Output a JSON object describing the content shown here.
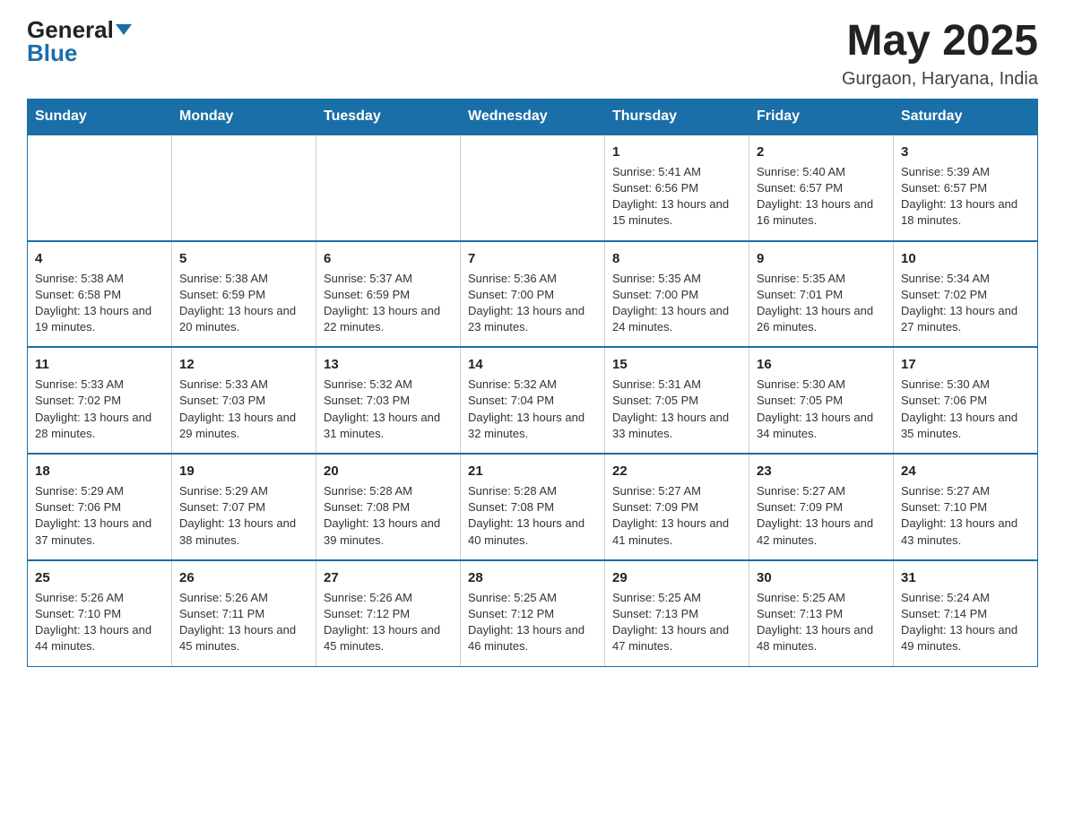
{
  "header": {
    "logo_general": "General",
    "logo_blue": "Blue",
    "title": "May 2025",
    "location": "Gurgaon, Haryana, India"
  },
  "calendar": {
    "days_of_week": [
      "Sunday",
      "Monday",
      "Tuesday",
      "Wednesday",
      "Thursday",
      "Friday",
      "Saturday"
    ],
    "weeks": [
      [
        {
          "day": "",
          "info": ""
        },
        {
          "day": "",
          "info": ""
        },
        {
          "day": "",
          "info": ""
        },
        {
          "day": "",
          "info": ""
        },
        {
          "day": "1",
          "info": "Sunrise: 5:41 AM\nSunset: 6:56 PM\nDaylight: 13 hours and 15 minutes."
        },
        {
          "day": "2",
          "info": "Sunrise: 5:40 AM\nSunset: 6:57 PM\nDaylight: 13 hours and 16 minutes."
        },
        {
          "day": "3",
          "info": "Sunrise: 5:39 AM\nSunset: 6:57 PM\nDaylight: 13 hours and 18 minutes."
        }
      ],
      [
        {
          "day": "4",
          "info": "Sunrise: 5:38 AM\nSunset: 6:58 PM\nDaylight: 13 hours and 19 minutes."
        },
        {
          "day": "5",
          "info": "Sunrise: 5:38 AM\nSunset: 6:59 PM\nDaylight: 13 hours and 20 minutes."
        },
        {
          "day": "6",
          "info": "Sunrise: 5:37 AM\nSunset: 6:59 PM\nDaylight: 13 hours and 22 minutes."
        },
        {
          "day": "7",
          "info": "Sunrise: 5:36 AM\nSunset: 7:00 PM\nDaylight: 13 hours and 23 minutes."
        },
        {
          "day": "8",
          "info": "Sunrise: 5:35 AM\nSunset: 7:00 PM\nDaylight: 13 hours and 24 minutes."
        },
        {
          "day": "9",
          "info": "Sunrise: 5:35 AM\nSunset: 7:01 PM\nDaylight: 13 hours and 26 minutes."
        },
        {
          "day": "10",
          "info": "Sunrise: 5:34 AM\nSunset: 7:02 PM\nDaylight: 13 hours and 27 minutes."
        }
      ],
      [
        {
          "day": "11",
          "info": "Sunrise: 5:33 AM\nSunset: 7:02 PM\nDaylight: 13 hours and 28 minutes."
        },
        {
          "day": "12",
          "info": "Sunrise: 5:33 AM\nSunset: 7:03 PM\nDaylight: 13 hours and 29 minutes."
        },
        {
          "day": "13",
          "info": "Sunrise: 5:32 AM\nSunset: 7:03 PM\nDaylight: 13 hours and 31 minutes."
        },
        {
          "day": "14",
          "info": "Sunrise: 5:32 AM\nSunset: 7:04 PM\nDaylight: 13 hours and 32 minutes."
        },
        {
          "day": "15",
          "info": "Sunrise: 5:31 AM\nSunset: 7:05 PM\nDaylight: 13 hours and 33 minutes."
        },
        {
          "day": "16",
          "info": "Sunrise: 5:30 AM\nSunset: 7:05 PM\nDaylight: 13 hours and 34 minutes."
        },
        {
          "day": "17",
          "info": "Sunrise: 5:30 AM\nSunset: 7:06 PM\nDaylight: 13 hours and 35 minutes."
        }
      ],
      [
        {
          "day": "18",
          "info": "Sunrise: 5:29 AM\nSunset: 7:06 PM\nDaylight: 13 hours and 37 minutes."
        },
        {
          "day": "19",
          "info": "Sunrise: 5:29 AM\nSunset: 7:07 PM\nDaylight: 13 hours and 38 minutes."
        },
        {
          "day": "20",
          "info": "Sunrise: 5:28 AM\nSunset: 7:08 PM\nDaylight: 13 hours and 39 minutes."
        },
        {
          "day": "21",
          "info": "Sunrise: 5:28 AM\nSunset: 7:08 PM\nDaylight: 13 hours and 40 minutes."
        },
        {
          "day": "22",
          "info": "Sunrise: 5:27 AM\nSunset: 7:09 PM\nDaylight: 13 hours and 41 minutes."
        },
        {
          "day": "23",
          "info": "Sunrise: 5:27 AM\nSunset: 7:09 PM\nDaylight: 13 hours and 42 minutes."
        },
        {
          "day": "24",
          "info": "Sunrise: 5:27 AM\nSunset: 7:10 PM\nDaylight: 13 hours and 43 minutes."
        }
      ],
      [
        {
          "day": "25",
          "info": "Sunrise: 5:26 AM\nSunset: 7:10 PM\nDaylight: 13 hours and 44 minutes."
        },
        {
          "day": "26",
          "info": "Sunrise: 5:26 AM\nSunset: 7:11 PM\nDaylight: 13 hours and 45 minutes."
        },
        {
          "day": "27",
          "info": "Sunrise: 5:26 AM\nSunset: 7:12 PM\nDaylight: 13 hours and 45 minutes."
        },
        {
          "day": "28",
          "info": "Sunrise: 5:25 AM\nSunset: 7:12 PM\nDaylight: 13 hours and 46 minutes."
        },
        {
          "day": "29",
          "info": "Sunrise: 5:25 AM\nSunset: 7:13 PM\nDaylight: 13 hours and 47 minutes."
        },
        {
          "day": "30",
          "info": "Sunrise: 5:25 AM\nSunset: 7:13 PM\nDaylight: 13 hours and 48 minutes."
        },
        {
          "day": "31",
          "info": "Sunrise: 5:24 AM\nSunset: 7:14 PM\nDaylight: 13 hours and 49 minutes."
        }
      ]
    ]
  }
}
